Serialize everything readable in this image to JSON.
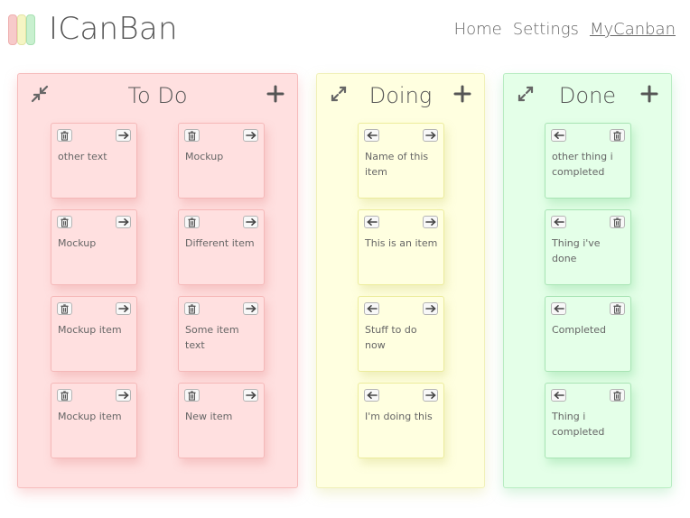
{
  "app": {
    "title": "ICanBan",
    "logo_colors": [
      "#f7caca",
      "#f5f5c4",
      "#c8f0cf"
    ]
  },
  "nav": [
    {
      "label": "Home",
      "active": false
    },
    {
      "label": "Settings",
      "active": false
    },
    {
      "label": "MyCanban",
      "active": true
    }
  ],
  "columns": [
    {
      "title": "To Do",
      "color": "#ffe0e0",
      "toggle_icon": "compress-icon",
      "add_icon": "plus-icon",
      "cards": [
        {
          "text": "other text"
        },
        {
          "text": "Mockup"
        },
        {
          "text": "Mockup"
        },
        {
          "text": "Different item"
        },
        {
          "text": "Mockup item"
        },
        {
          "text": "Some item text"
        },
        {
          "text": "Mockup item"
        },
        {
          "text": "New item"
        }
      ]
    },
    {
      "title": "Doing",
      "color": "#ffffe0",
      "toggle_icon": "expand-icon",
      "add_icon": "plus-icon",
      "cards": [
        {
          "text": "Name of this item"
        },
        {
          "text": "This is an item"
        },
        {
          "text": "Stuff to do now"
        },
        {
          "text": "I'm doing this"
        }
      ]
    },
    {
      "title": "Done",
      "color": "#e4ffe8",
      "toggle_icon": "expand-icon",
      "add_icon": "plus-icon",
      "cards": [
        {
          "text": "other thing i completed"
        },
        {
          "text": "Thing i've done"
        },
        {
          "text": "Completed"
        },
        {
          "text": "Thing i completed"
        }
      ]
    }
  ]
}
